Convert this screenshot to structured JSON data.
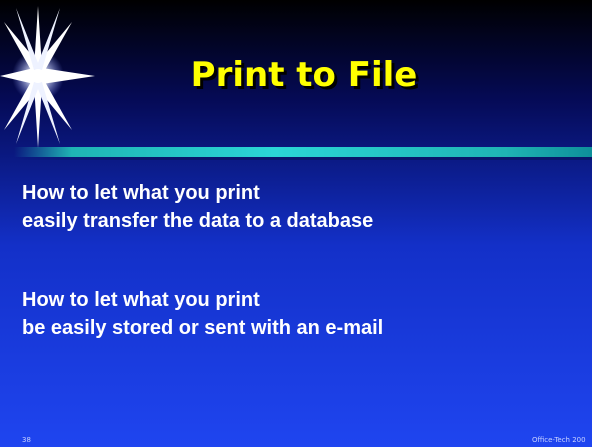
{
  "slide": {
    "title": "Print to File",
    "paragraphs": [
      {
        "lines": [
          "How to let what you print",
          "easily transfer the data to a database"
        ]
      },
      {
        "lines": [
          "How to let what you print",
          "be easily stored or sent with an e-mail"
        ]
      }
    ],
    "slide_number": "38",
    "footer": "Office-Tech 200",
    "decoration_icon": "sparkle-star-icon"
  },
  "colors": {
    "title": "#ffff00",
    "body_text": "#ffffff",
    "accent_bar": "#2bd6d6",
    "background_top": "#000000",
    "background_bottom": "#1f45f0"
  }
}
